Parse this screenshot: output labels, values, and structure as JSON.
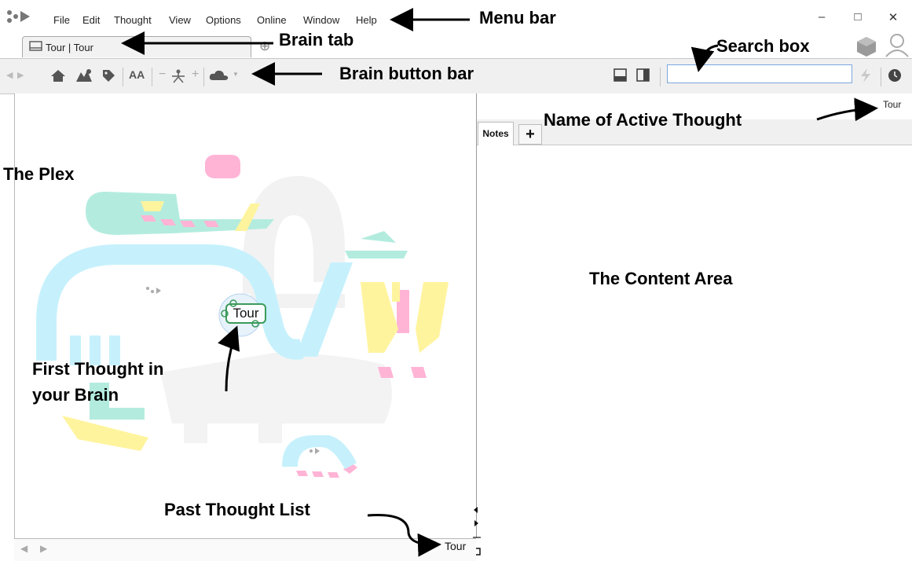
{
  "menubar": {
    "items": [
      "File",
      "Edit",
      "Thought",
      "View",
      "Options",
      "Online",
      "Window",
      "Help"
    ],
    "window_controls": {
      "minimize": "–",
      "maximize": "□",
      "close": "✕"
    }
  },
  "brain_tab": {
    "label": "Tour | Tour",
    "add_tab_icon": "⊕"
  },
  "button_bar": {
    "text_size_label": "AA",
    "search": {
      "value": "",
      "placeholder": ""
    }
  },
  "plex": {
    "active_thought": "Tour",
    "bottom_nav": {
      "back": "◀",
      "forward": "▶"
    }
  },
  "content": {
    "active_thought_name": "Tour",
    "tabs": [
      {
        "label": "Notes"
      }
    ],
    "add_tab_label": "+"
  },
  "past_thought_list": {
    "current": "Tour"
  },
  "annotations": {
    "menu_bar": "Menu bar",
    "brain_tab": "Brain tab",
    "search_box": "Search box",
    "brain_button_bar": "Brain button bar",
    "name_of_active_thought": "Name of Active Thought",
    "the_plex": "The Plex",
    "the_content_area": "The Content Area",
    "first_thought_line1": "First Thought in",
    "first_thought_line2": "your Brain",
    "past_thought_list": "Past Thought List"
  },
  "colors": {
    "node_border": "#3b9a5a",
    "plex_blue": "#bdeffd",
    "plex_green": "#aeeadc",
    "plex_yellow": "#fff3a0",
    "plex_pink": "#ffaad2"
  }
}
